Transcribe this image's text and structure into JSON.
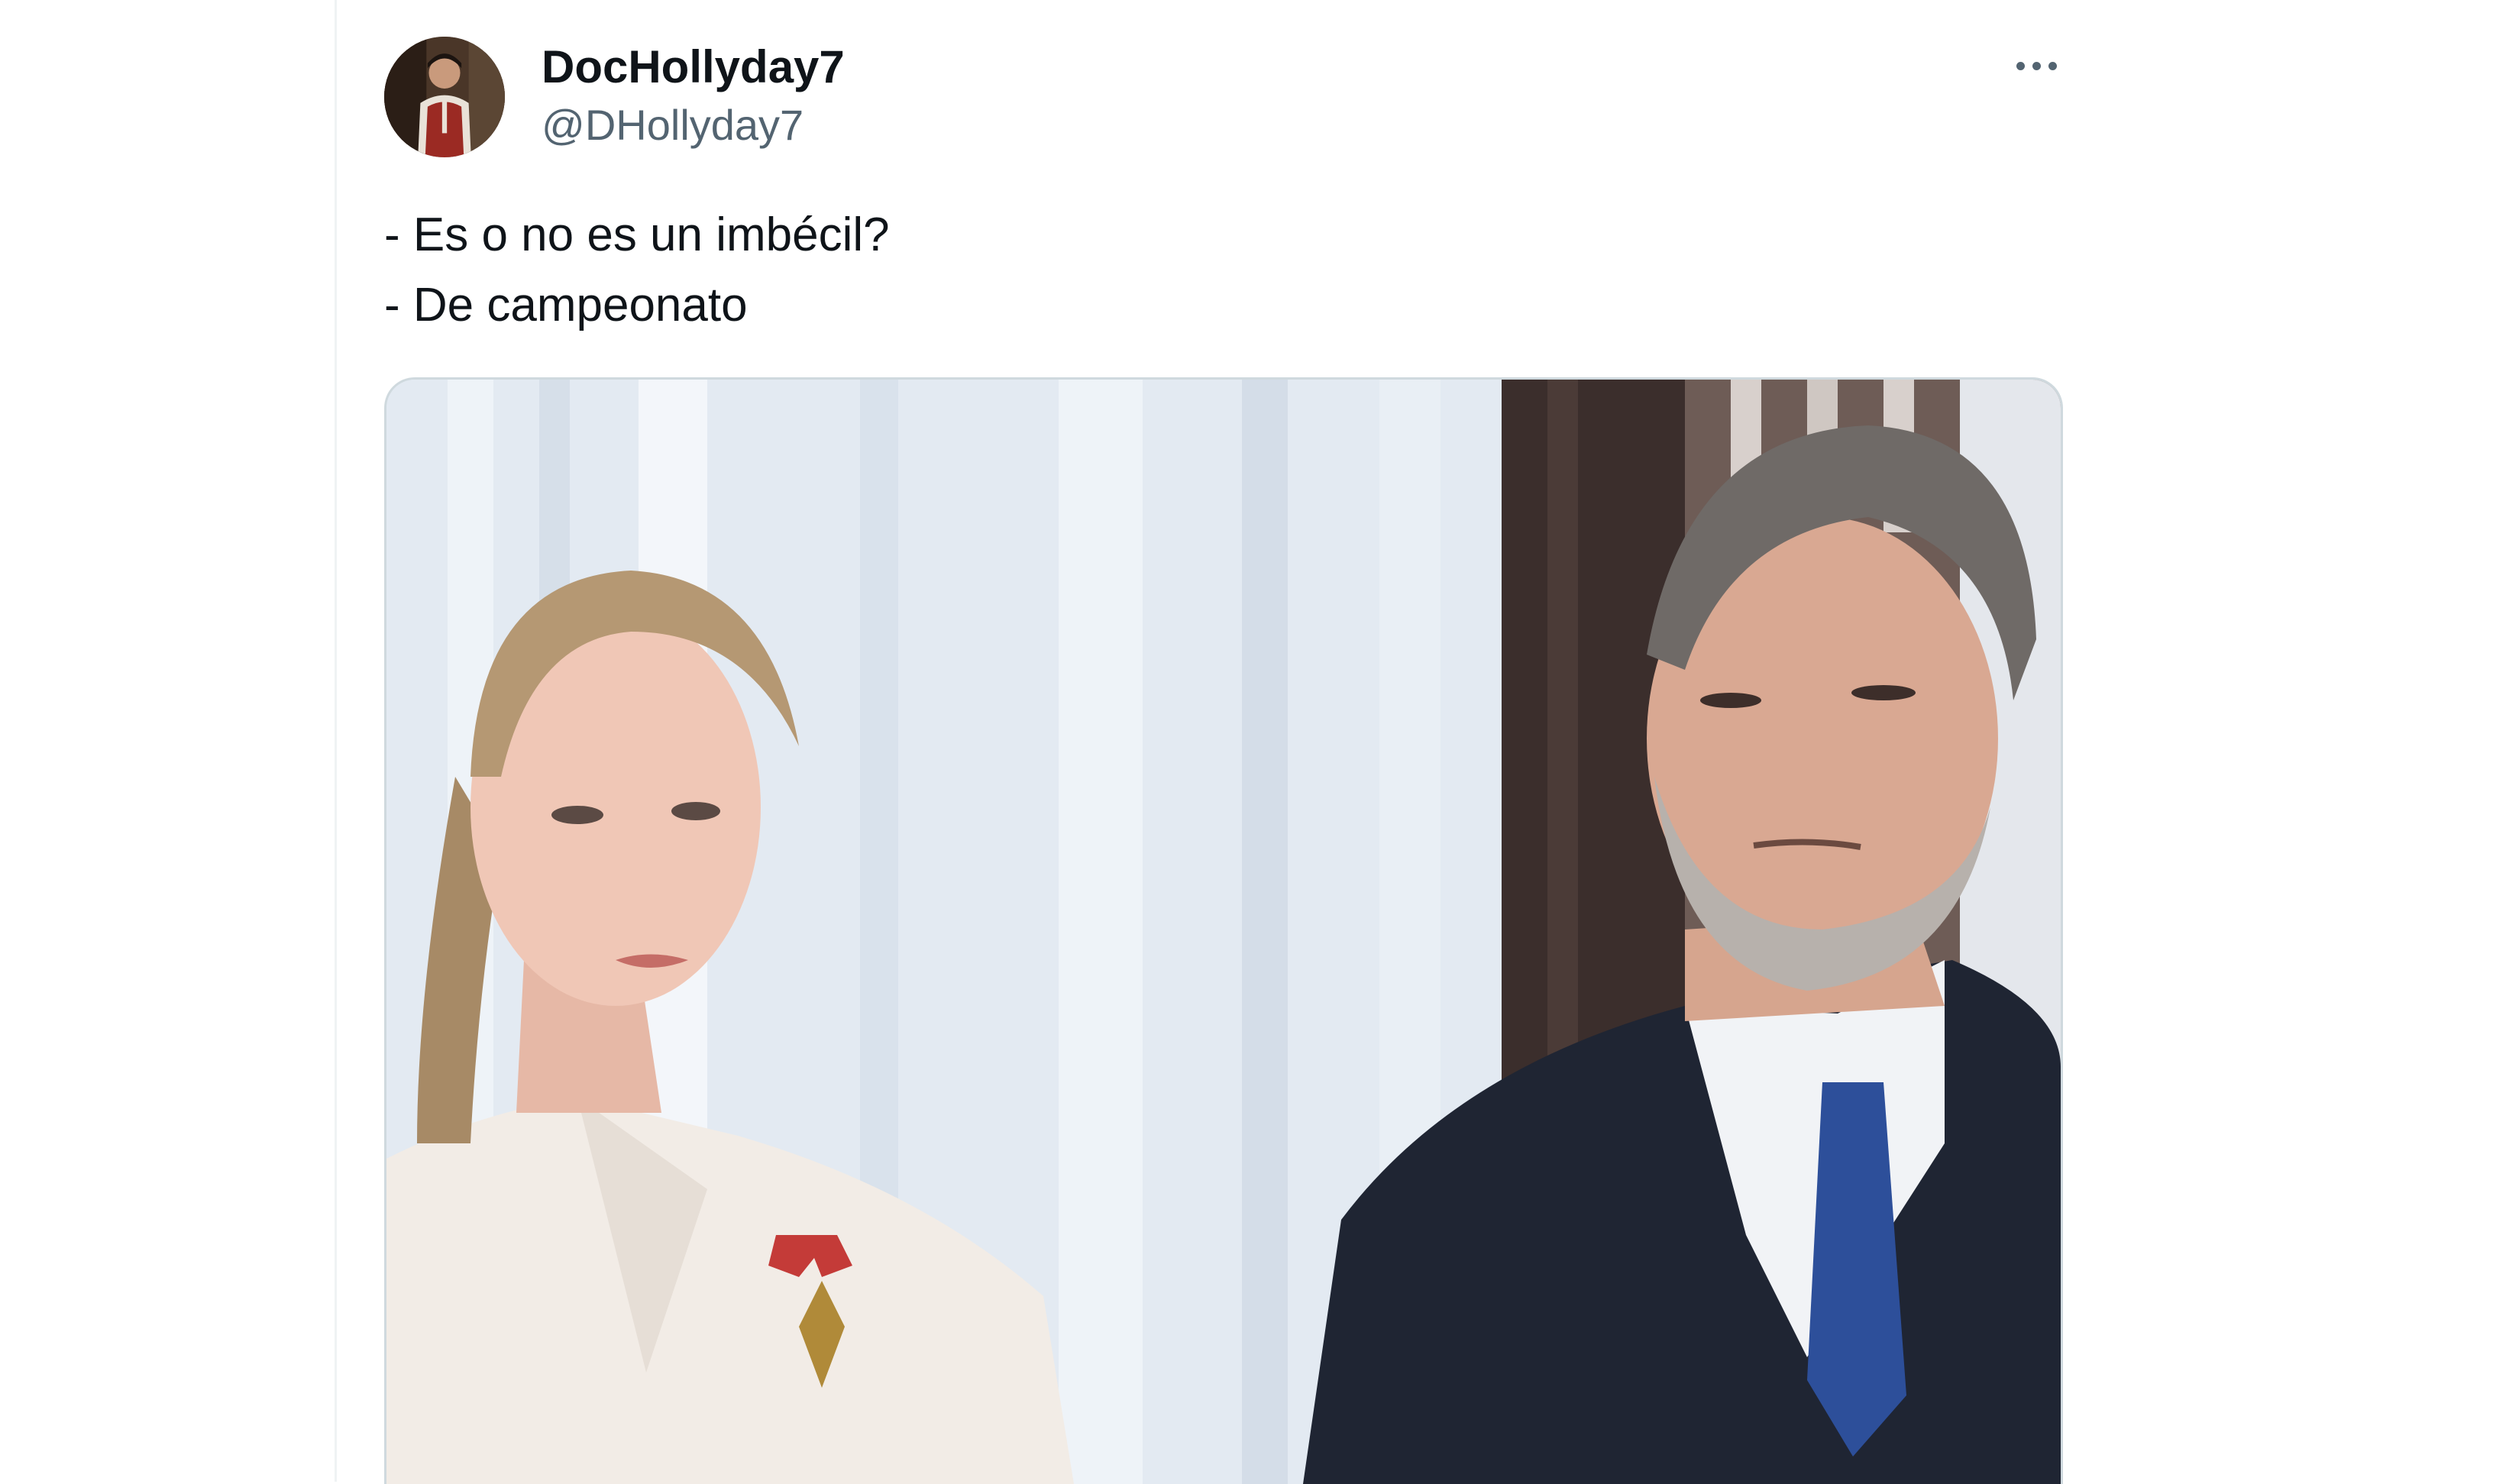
{
  "tweet": {
    "author": {
      "display_name": "DocHollyday7",
      "handle": "@DHollyday7",
      "avatar_icon": "user-avatar"
    },
    "more_icon": "more-horizontal-icon",
    "text_lines": [
      "- Es o no es un imbécil?",
      "- De campeonato"
    ]
  },
  "colors": {
    "text_primary": "#0f1419",
    "text_secondary": "#536471",
    "border": "#cfd9de"
  }
}
